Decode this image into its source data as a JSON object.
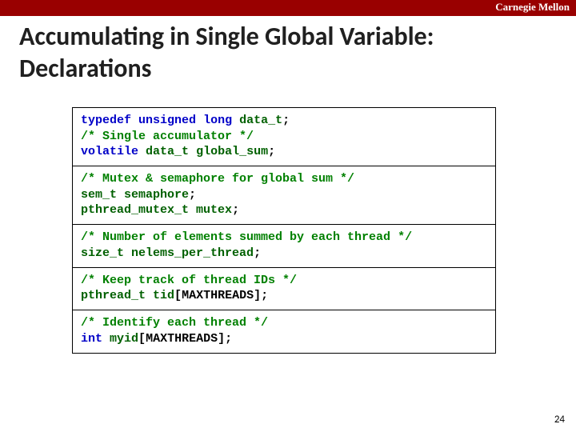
{
  "org": "Carnegie Mellon",
  "title": "Accumulating in Single Global Variable: Declarations",
  "page_number": "24",
  "blocks": {
    "b1": {
      "kw_typedef": "typedef",
      "kw_unsigned": "unsigned",
      "kw_long": "long",
      "t_data_t": "data_t",
      "semi": ";",
      "cmt": "/* Single accumulator */",
      "kw_volatile": "volatile",
      "t_data_t2": "data_t",
      "v_global_sum": "global_sum"
    },
    "b2": {
      "cmt": "/* Mutex & semaphore for global sum */",
      "t_sem_t": "sem_t",
      "v_semaphore": "semaphore",
      "t_pthread_mutex_t": "pthread_mutex_t",
      "v_mutex": "mutex"
    },
    "b3": {
      "cmt": "/* Number of elements summed by each thread */",
      "t_size_t": "size_t",
      "v_nelems": "nelems_per_thread"
    },
    "b4": {
      "cmt": "/* Keep track of thread IDs */",
      "t_pthread_t": "pthread_t",
      "v_tid": "tid",
      "lbr": "[",
      "c_max": "MAXTHREADS",
      "rbr_semi": "];"
    },
    "b5": {
      "cmt": "/* Identify each thread */",
      "kw_int": "int",
      "v_myid": "myid",
      "lbr": "[",
      "c_max": "MAXTHREADS",
      "rbr_semi": "];"
    }
  }
}
